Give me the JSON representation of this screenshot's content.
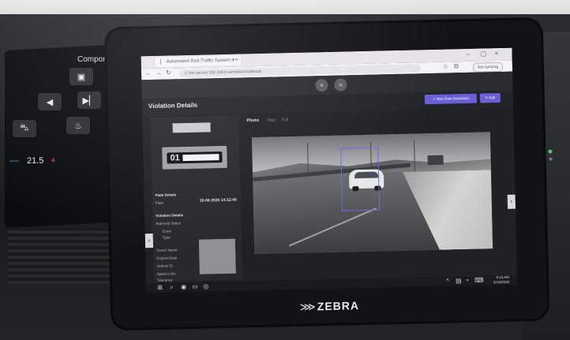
{
  "car_display": {
    "title": "Component",
    "temperature": "21.5",
    "minus": "—",
    "plus": "+"
  },
  "tablet": {
    "brand": "ZEBRA"
  },
  "browser": {
    "tab_title": "Automated Red Traffic System",
    "address_security": "Not secure",
    "url": "192.168.0.xx/violations/details",
    "profile": "Not syncing"
  },
  "app": {
    "page_title": "Violation Details",
    "download_button": "Raw Data Download",
    "edit_button": "Edit",
    "photo_tabs": [
      "Photo",
      "Map",
      "Full"
    ],
    "timestamp": "19-06-2026 14:12:46",
    "sections": {
      "plate_details": "Plate Details",
      "violation_details": "Violation Details",
      "vehicle_details": "Vehicle Details"
    },
    "fields": [
      "Plate",
      "Approval Status",
      "Event",
      "Type",
      "Owner Name",
      "Expired Date",
      "Vehicle ID",
      "Speed Limit",
      "Tolerance",
      "Lane"
    ],
    "plate_prefix": "01"
  },
  "taskbar": {
    "time": "9:15 AM",
    "date": "6/19/2026"
  },
  "colors": {
    "accent": "#6a5fd8",
    "detection_box": "#6b68e6"
  }
}
